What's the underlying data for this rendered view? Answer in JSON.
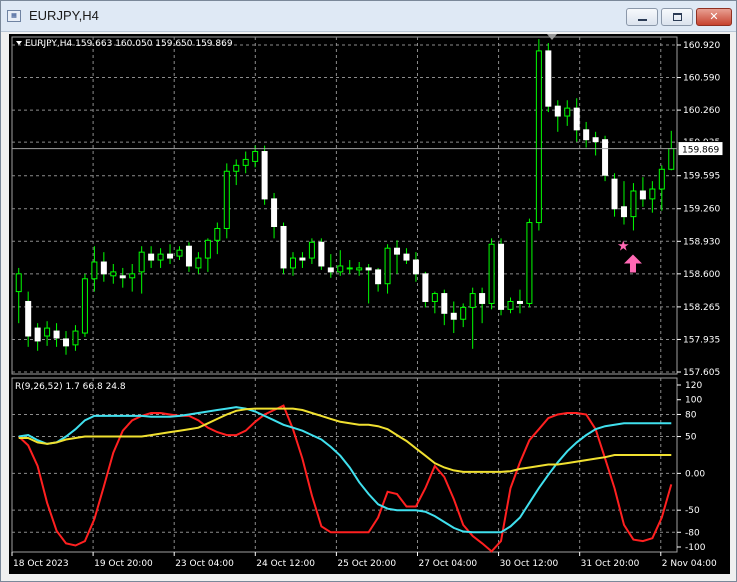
{
  "window": {
    "title": "EURJPY,H4",
    "icon": "chart-window-icon",
    "buttons": [
      "minimize-icon",
      "maximize-icon",
      "close-icon"
    ]
  },
  "chart": {
    "header": "EURJPY,H4  159.663 160.050 159.650 159.869",
    "current_price_label": "159.869",
    "price_axis_labels": [
      "160.920",
      "160.590",
      "160.260",
      "159.935",
      "159.595",
      "159.260",
      "158.930",
      "158.600",
      "158.265",
      "157.935",
      "157.605"
    ],
    "indicator_header": "R(9,26,52) 1.7 66.8 24.8",
    "indicator_axis_labels": [
      "120",
      "100",
      "80",
      "50",
      "0.00",
      "-50",
      "-80",
      "-100"
    ],
    "time_labels": [
      "18 Oct 2023",
      "19 Oct 20:00",
      "23 Oct 04:00",
      "24 Oct 12:00",
      "25 Oct 20:00",
      "27 Oct 04:00",
      "30 Oct 12:00",
      "31 Oct 20:00",
      "2 Nov 04:00"
    ],
    "colors": {
      "background": "#000000",
      "bull": "#00ff00",
      "bear": "#ffffff",
      "grid": "#8c8c8c",
      "line_red": "#ff2020",
      "line_cyan": "#40e0ee",
      "line_yellow": "#f0e030",
      "marker": "#ff69b4"
    }
  },
  "chart_data": [
    {
      "type": "candlestick",
      "title": "EURJPY,H4",
      "ylim": [
        157.605,
        160.92
      ],
      "candles": [
        {
          "o": 158.42,
          "h": 158.66,
          "l": 158.1,
          "c": 158.6
        },
        {
          "o": 158.32,
          "h": 158.42,
          "l": 157.86,
          "c": 157.97
        },
        {
          "o": 158.05,
          "h": 158.1,
          "l": 157.82,
          "c": 157.92
        },
        {
          "o": 157.97,
          "h": 158.12,
          "l": 157.87,
          "c": 158.05
        },
        {
          "o": 158.02,
          "h": 158.1,
          "l": 157.86,
          "c": 157.95
        },
        {
          "o": 157.94,
          "h": 158.02,
          "l": 157.78,
          "c": 157.87
        },
        {
          "o": 157.88,
          "h": 158.08,
          "l": 157.82,
          "c": 158.02
        },
        {
          "o": 158.0,
          "h": 158.6,
          "l": 157.96,
          "c": 158.55
        },
        {
          "o": 158.55,
          "h": 158.88,
          "l": 158.42,
          "c": 158.72
        },
        {
          "o": 158.72,
          "h": 158.82,
          "l": 158.52,
          "c": 158.6
        },
        {
          "o": 158.58,
          "h": 158.7,
          "l": 158.5,
          "c": 158.62
        },
        {
          "o": 158.58,
          "h": 158.66,
          "l": 158.46,
          "c": 158.56
        },
        {
          "o": 158.56,
          "h": 158.7,
          "l": 158.42,
          "c": 158.6
        },
        {
          "o": 158.62,
          "h": 158.88,
          "l": 158.4,
          "c": 158.82
        },
        {
          "o": 158.8,
          "h": 158.88,
          "l": 158.66,
          "c": 158.74
        },
        {
          "o": 158.74,
          "h": 158.86,
          "l": 158.66,
          "c": 158.8
        },
        {
          "o": 158.8,
          "h": 158.9,
          "l": 158.7,
          "c": 158.76
        },
        {
          "o": 158.78,
          "h": 158.88,
          "l": 158.74,
          "c": 158.84
        },
        {
          "o": 158.88,
          "h": 158.92,
          "l": 158.62,
          "c": 158.68
        },
        {
          "o": 158.66,
          "h": 158.82,
          "l": 158.6,
          "c": 158.76
        },
        {
          "o": 158.76,
          "h": 158.96,
          "l": 158.62,
          "c": 158.94
        },
        {
          "o": 158.94,
          "h": 159.12,
          "l": 158.8,
          "c": 159.06
        },
        {
          "o": 159.06,
          "h": 159.72,
          "l": 158.96,
          "c": 159.64
        },
        {
          "o": 159.64,
          "h": 159.76,
          "l": 159.5,
          "c": 159.7
        },
        {
          "o": 159.7,
          "h": 159.84,
          "l": 159.62,
          "c": 159.76
        },
        {
          "o": 159.74,
          "h": 159.9,
          "l": 159.68,
          "c": 159.84
        },
        {
          "o": 159.84,
          "h": 159.9,
          "l": 159.3,
          "c": 159.36
        },
        {
          "o": 159.36,
          "h": 159.42,
          "l": 158.96,
          "c": 159.08
        },
        {
          "o": 159.08,
          "h": 159.12,
          "l": 158.6,
          "c": 158.66
        },
        {
          "o": 158.66,
          "h": 158.82,
          "l": 158.58,
          "c": 158.76
        },
        {
          "o": 158.76,
          "h": 158.82,
          "l": 158.66,
          "c": 158.74
        },
        {
          "o": 158.76,
          "h": 158.96,
          "l": 158.7,
          "c": 158.92
        },
        {
          "o": 158.92,
          "h": 158.96,
          "l": 158.64,
          "c": 158.68
        },
        {
          "o": 158.66,
          "h": 158.8,
          "l": 158.56,
          "c": 158.62
        },
        {
          "o": 158.62,
          "h": 158.84,
          "l": 158.58,
          "c": 158.68
        },
        {
          "o": 158.66,
          "h": 158.74,
          "l": 158.6,
          "c": 158.66
        },
        {
          "o": 158.64,
          "h": 158.72,
          "l": 158.58,
          "c": 158.66
        },
        {
          "o": 158.66,
          "h": 158.7,
          "l": 158.3,
          "c": 158.64
        },
        {
          "o": 158.64,
          "h": 158.66,
          "l": 158.42,
          "c": 158.5
        },
        {
          "o": 158.5,
          "h": 158.9,
          "l": 158.4,
          "c": 158.86
        },
        {
          "o": 158.86,
          "h": 158.94,
          "l": 158.6,
          "c": 158.8
        },
        {
          "o": 158.8,
          "h": 158.86,
          "l": 158.7,
          "c": 158.74
        },
        {
          "o": 158.74,
          "h": 158.82,
          "l": 158.52,
          "c": 158.6
        },
        {
          "o": 158.6,
          "h": 158.62,
          "l": 158.26,
          "c": 158.32
        },
        {
          "o": 158.32,
          "h": 158.42,
          "l": 158.2,
          "c": 158.4
        },
        {
          "o": 158.4,
          "h": 158.44,
          "l": 158.08,
          "c": 158.2
        },
        {
          "o": 158.2,
          "h": 158.32,
          "l": 158.0,
          "c": 158.14
        },
        {
          "o": 158.14,
          "h": 158.3,
          "l": 158.06,
          "c": 158.26
        },
        {
          "o": 158.26,
          "h": 158.46,
          "l": 157.84,
          "c": 158.4
        },
        {
          "o": 158.4,
          "h": 158.46,
          "l": 158.1,
          "c": 158.3
        },
        {
          "o": 158.3,
          "h": 158.96,
          "l": 158.24,
          "c": 158.9
        },
        {
          "o": 158.9,
          "h": 158.96,
          "l": 158.18,
          "c": 158.24
        },
        {
          "o": 158.24,
          "h": 158.36,
          "l": 158.2,
          "c": 158.32
        },
        {
          "o": 158.32,
          "h": 158.44,
          "l": 158.2,
          "c": 158.3
        },
        {
          "o": 158.3,
          "h": 159.16,
          "l": 158.26,
          "c": 159.12
        },
        {
          "o": 159.12,
          "h": 160.98,
          "l": 159.04,
          "c": 160.86
        },
        {
          "o": 160.86,
          "h": 160.94,
          "l": 160.24,
          "c": 160.3
        },
        {
          "o": 160.3,
          "h": 160.36,
          "l": 160.04,
          "c": 160.2
        },
        {
          "o": 160.2,
          "h": 160.36,
          "l": 160.1,
          "c": 160.28
        },
        {
          "o": 160.28,
          "h": 160.38,
          "l": 159.94,
          "c": 160.06
        },
        {
          "o": 160.06,
          "h": 160.14,
          "l": 159.88,
          "c": 159.96
        },
        {
          "o": 159.98,
          "h": 160.04,
          "l": 159.8,
          "c": 159.94
        },
        {
          "o": 159.96,
          "h": 160.0,
          "l": 159.54,
          "c": 159.6
        },
        {
          "o": 159.56,
          "h": 159.62,
          "l": 159.18,
          "c": 159.26
        },
        {
          "o": 159.28,
          "h": 159.54,
          "l": 159.1,
          "c": 159.18
        },
        {
          "o": 159.18,
          "h": 159.52,
          "l": 159.04,
          "c": 159.44
        },
        {
          "o": 159.44,
          "h": 159.58,
          "l": 159.28,
          "c": 159.36
        },
        {
          "o": 159.36,
          "h": 159.54,
          "l": 159.22,
          "c": 159.46
        },
        {
          "o": 159.46,
          "h": 159.7,
          "l": 159.24,
          "c": 159.66
        },
        {
          "o": 159.66,
          "h": 160.05,
          "l": 159.65,
          "c": 159.87
        }
      ]
    },
    {
      "type": "line",
      "title": "R(9,26,52)",
      "ylim": [
        -100,
        120
      ],
      "series": [
        {
          "name": "R(9)",
          "color": "#ff2020",
          "values": [
            50,
            38,
            10,
            -40,
            -78,
            -95,
            -98,
            -92,
            -62,
            -18,
            28,
            58,
            72,
            78,
            82,
            82,
            80,
            78,
            78,
            72,
            62,
            56,
            52,
            52,
            58,
            70,
            80,
            86,
            92,
            60,
            20,
            -30,
            -72,
            -80,
            -80,
            -80,
            -80,
            -80,
            -60,
            -25,
            -28,
            -45,
            -45,
            -20,
            10,
            -5,
            -35,
            -70,
            -85,
            -95,
            -106,
            -92,
            -20,
            15,
            45,
            60,
            75,
            80,
            82,
            82,
            80,
            60,
            20,
            -20,
            -70,
            -90,
            -92,
            -88,
            -60,
            -15
          ]
        },
        {
          "name": "R(26)",
          "color": "#40e0ee",
          "values": [
            50,
            52,
            45,
            40,
            42,
            50,
            60,
            72,
            78,
            78,
            78,
            78,
            78,
            78,
            77,
            77,
            77,
            78,
            80,
            82,
            84,
            86,
            88,
            90,
            88,
            84,
            78,
            72,
            66,
            62,
            58,
            52,
            46,
            36,
            24,
            8,
            -12,
            -28,
            -42,
            -48,
            -50,
            -50,
            -50,
            -52,
            -58,
            -66,
            -74,
            -79,
            -80,
            -80,
            -80,
            -80,
            -72,
            -60,
            -40,
            -20,
            -2,
            15,
            30,
            42,
            52,
            60,
            64,
            66,
            68,
            68,
            68,
            68,
            68,
            68
          ]
        },
        {
          "name": "R(52)",
          "color": "#f0e030",
          "values": [
            48,
            48,
            42,
            40,
            42,
            46,
            48,
            50,
            50,
            50,
            50,
            50,
            50,
            50,
            52,
            54,
            56,
            58,
            60,
            62,
            68,
            74,
            80,
            85,
            87,
            88,
            88,
            88,
            88,
            88,
            86,
            82,
            78,
            74,
            70,
            68,
            66,
            66,
            64,
            60,
            52,
            44,
            34,
            24,
            14,
            8,
            4,
            2,
            2,
            2,
            2,
            2,
            3,
            6,
            8,
            10,
            12,
            12,
            14,
            16,
            18,
            20,
            22,
            25,
            25,
            25,
            25,
            25,
            25,
            25
          ]
        }
      ]
    }
  ]
}
